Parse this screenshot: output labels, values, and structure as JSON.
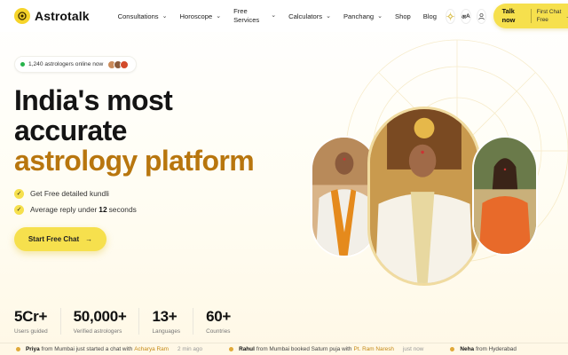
{
  "header": {
    "brand": "Astrotalk",
    "nav": [
      {
        "label": "Consultations",
        "has_menu": true
      },
      {
        "label": "Horoscope",
        "has_menu": true
      },
      {
        "label": "Free Services",
        "has_menu": true
      },
      {
        "label": "Calculators",
        "has_menu": true
      },
      {
        "label": "Panchang",
        "has_menu": true
      },
      {
        "label": "Shop",
        "has_menu": false
      },
      {
        "label": "Blog",
        "has_menu": false
      }
    ],
    "theme_icon": "sun-icon",
    "language_label": "अ",
    "language_label_suffix": "A",
    "user_icon": "user-icon",
    "talk_button": {
      "main": "Talk now",
      "sub": "First Chat Free",
      "arrow": "→"
    }
  },
  "online": {
    "text": "1,240 astrologers online now"
  },
  "hero": {
    "line1": "India's most",
    "line2": "accurate",
    "line3": "astrology platform",
    "benefits": [
      {
        "text": "Get Free detailed kundli"
      },
      {
        "prefix": "Average reply under",
        "bold": "12",
        "suffix": "seconds"
      }
    ],
    "cta": "Start Free Chat",
    "cta_arrow": "→"
  },
  "stats": [
    {
      "value": "5Cr+",
      "label": "Users guided"
    },
    {
      "value": "50,000+",
      "label": "Verified astrologers"
    },
    {
      "value": "13+",
      "label": "Languages"
    },
    {
      "value": "60+",
      "label": "Countries"
    }
  ],
  "ticker": [
    {
      "name": "Priya",
      "text1": "from Mumbai just started a chat with",
      "link": "Acharya Ram",
      "time": "2 min ago"
    },
    {
      "name": "Rahul",
      "text1": "from Mumbai booked Saturn puja with",
      "link": "Pt. Ram Naresh",
      "time": "just now"
    },
    {
      "name": "Neha",
      "text1": "from Hyderabad",
      "link": "",
      "time": ""
    }
  ],
  "colors": {
    "accent_yellow": "#f6e04d",
    "headline_accent": "#b8760e",
    "online_green": "#27b34b"
  }
}
